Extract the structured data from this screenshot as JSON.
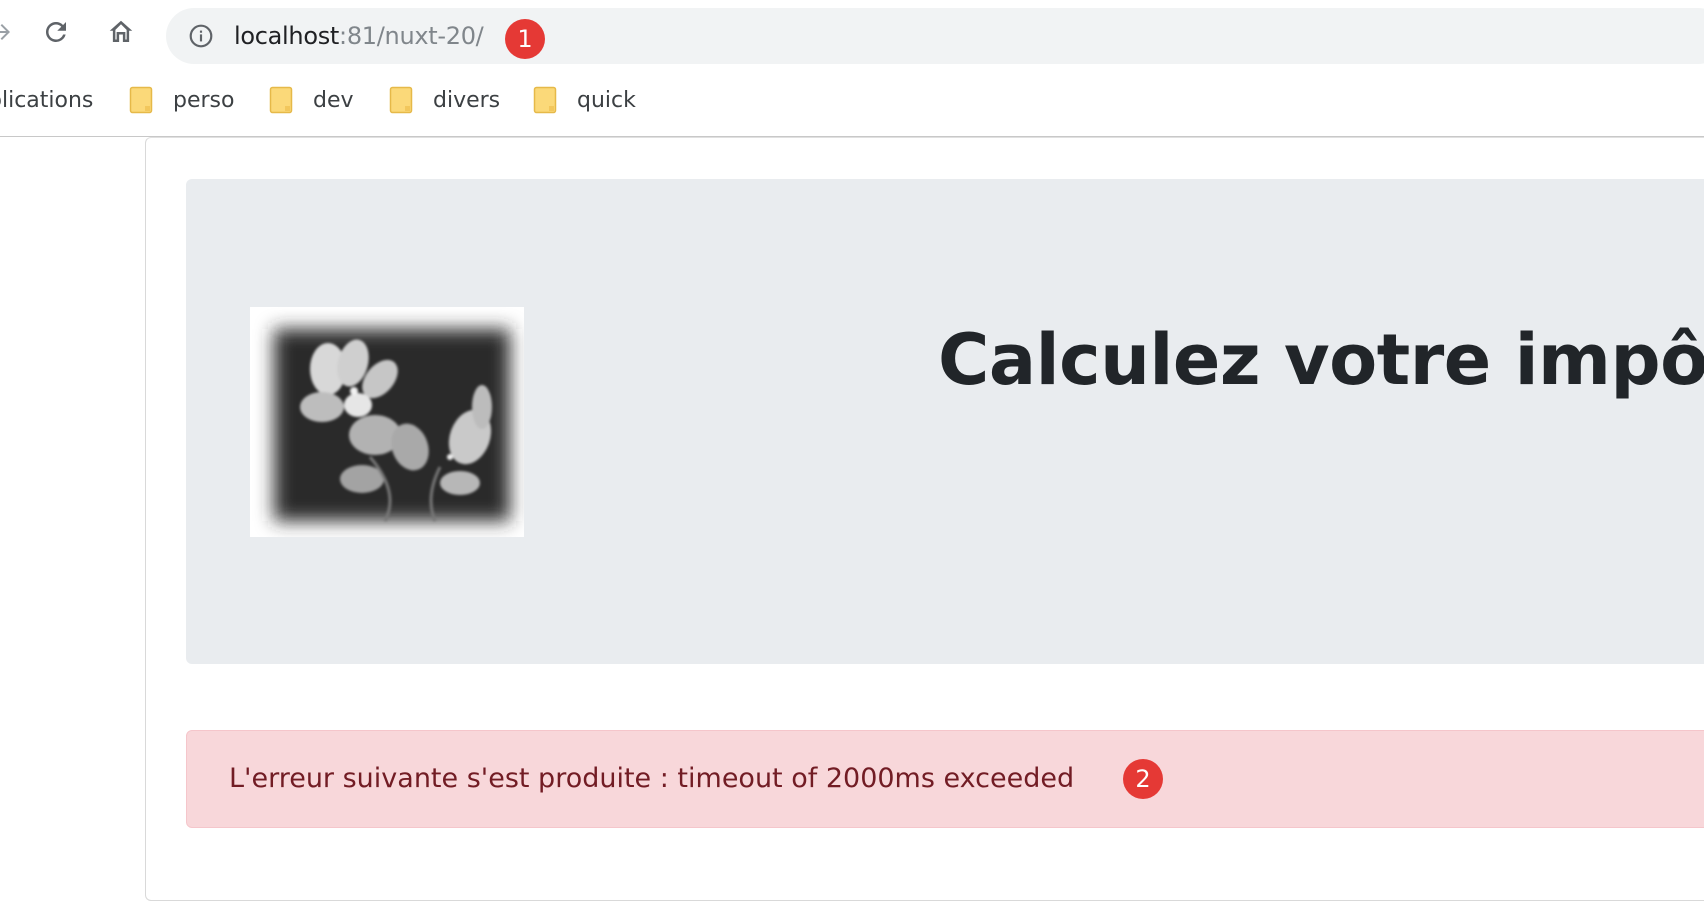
{
  "browser": {
    "url_host": "localhost",
    "url_path": ":81/nuxt-20/",
    "url_badge": "1",
    "bookmarks": [
      {
        "label": "plications",
        "icon": "apps-icon"
      },
      {
        "label": "perso",
        "icon": "folder-icon"
      },
      {
        "label": "dev",
        "icon": "folder-icon"
      },
      {
        "label": "divers",
        "icon": "folder-icon"
      },
      {
        "label": "quick",
        "icon": "folder-icon"
      }
    ],
    "icons": {
      "forward": "forward-arrow-icon",
      "reload": "reload-icon",
      "home": "home-icon",
      "info": "info-icon"
    }
  },
  "page": {
    "title": "Calculez votre impôt",
    "logo": "flower-logo",
    "alert": {
      "text": "L'erreur suivante s'est produite : timeout of 2000ms exceeded",
      "badge": "2"
    }
  },
  "colors": {
    "jumbotron_bg": "#e9ecef",
    "alert_bg": "#f8d7da",
    "alert_text": "#721c24",
    "badge": "#e53935",
    "folder": "#fbd979"
  }
}
